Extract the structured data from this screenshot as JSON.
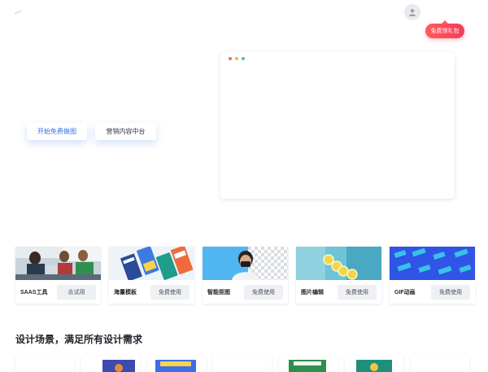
{
  "header": {
    "logo_icon": "logo-icon",
    "avatar_icon": "user-icon",
    "gift_label": "免费领礼包"
  },
  "hero": {
    "primary_button": "开始免费做图",
    "secondary_button": "营销内容中台",
    "preview_dots": [
      "#f06b5d",
      "#f5b93d",
      "#5cc56b"
    ]
  },
  "tools": [
    {
      "name": "SAAS工具",
      "action": "去试用"
    },
    {
      "name": "海量模板",
      "action": "免费使用"
    },
    {
      "name": "智能抠图",
      "action": "免费使用"
    },
    {
      "name": "图片编辑",
      "action": "免费使用"
    },
    {
      "name": "GIF动画",
      "action": "免费使用"
    }
  ],
  "scenes": {
    "title": "设计场景，满足所有设计需求"
  },
  "colors": {
    "accent": "#2f6fe4",
    "gift_gradient_start": "#ff5a5f",
    "gift_gradient_end": "#f23d57"
  }
}
